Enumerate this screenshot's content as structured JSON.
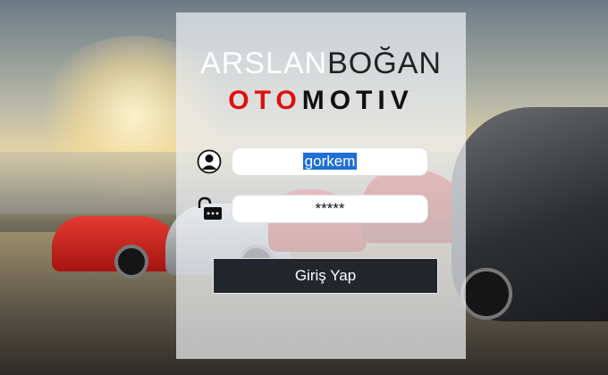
{
  "brand": {
    "line1_part1": "ARSLAN",
    "line1_part2": "BOĞAN",
    "line2_red": "OTO",
    "line2_dark": "MOTIV"
  },
  "form": {
    "username_value": "gorkem",
    "password_value": "*****",
    "submit_label": "Giriş Yap"
  },
  "colors": {
    "brand_red": "#e10e0e",
    "button_bg": "#23272d",
    "selection": "#1f6fd6"
  },
  "icons": {
    "username": "user-icon",
    "password": "unlocked-padlock-icon"
  }
}
